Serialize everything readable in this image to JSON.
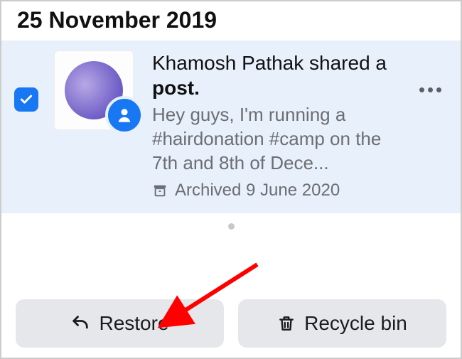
{
  "dateHeader": "25 November 2019",
  "item": {
    "selected": true,
    "author": "Khamosh Pathak",
    "action": "shared a",
    "object": "post",
    "bodyPreview": "Hey guys, I'm running a #hairdonation #camp on the 7th and 8th of Dece...",
    "archivedLabel": "Archived 9 June 2020"
  },
  "buttons": {
    "restore": "Restore",
    "recycle": "Recycle bin"
  },
  "icons": {
    "check": "checkmark-icon",
    "person": "person-icon",
    "archive": "archive-icon",
    "more": "more-icon",
    "undo": "undo-icon",
    "trash": "trash-icon"
  },
  "colors": {
    "accent": "#1877f2",
    "selectedBg": "#e8f0fb",
    "buttonBg": "#e6e7ea",
    "arrow": "#ff0000"
  },
  "annotation": {
    "target": "restore-button"
  }
}
